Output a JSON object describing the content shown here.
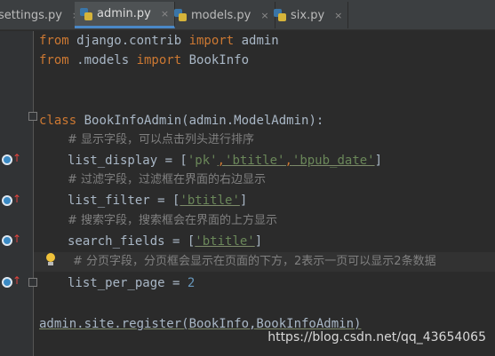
{
  "tabs": [
    {
      "label": "settings.py",
      "active": false
    },
    {
      "label": "admin.py",
      "active": true
    },
    {
      "label": "models.py",
      "active": false
    },
    {
      "label": "six.py",
      "active": false
    }
  ],
  "close_glyph": "×",
  "code": {
    "l1a": "from",
    "l1b": " django.contrib ",
    "l1c": "import",
    "l1d": " admin",
    "l2a": "from",
    "l2b": " .models ",
    "l2c": "import",
    "l2d": " BookInfo",
    "l3a": "class",
    "l3b": " BookInfoAdmin(admin.ModelAdmin):",
    "c1": "# 显示字段，可以点击列头进行排序",
    "l4a": "list_display = [",
    "l4b": "'pk'",
    "l4c": ",",
    "l4d": "'btitle'",
    "l4e": ",",
    "l4f": "'bpub_date'",
    "l4g": "]",
    "c2": "# 过滤字段，过滤框在界面的右边显示",
    "l5a": "list_filter = [",
    "l5b": "'btitle'",
    "l5c": "]",
    "c3": "# 搜索字段，搜索框会在界面的上方显示",
    "l6a": "search_fields = [",
    "l6b": "'btitle'",
    "l6c": "]",
    "c4": "# 分页字段，分页框会显示在页面的下方，2表示一页可以显示2条数据",
    "l7a": "list_per_page = ",
    "l7b": "2",
    "l8": "admin.site.register(BookInfo,BookInfoAdmin)"
  },
  "watermark": "https://blog.csdn.net/qq_43654065"
}
